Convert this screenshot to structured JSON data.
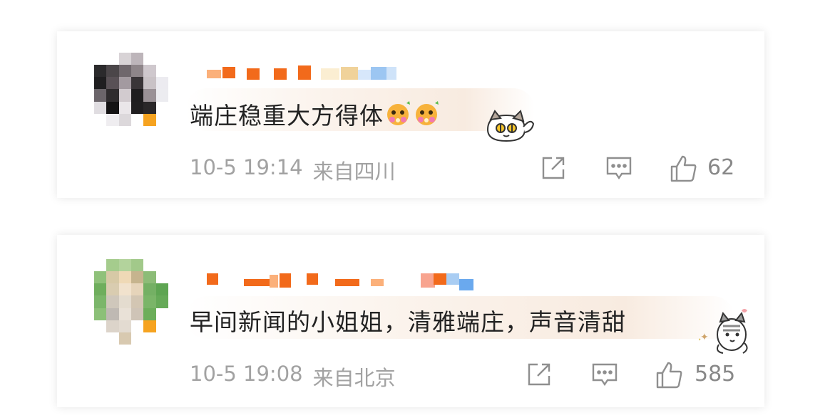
{
  "comments": [
    {
      "text": "端庄稳重大方得体",
      "emojis": [
        "flower-cheeks-emoji",
        "flower-cheeks-emoji"
      ],
      "sticker": "cat-sticker",
      "time": "10-5 19:14",
      "location": "来自四川",
      "likes": "62",
      "icons": [
        "share-icon",
        "comment-icon",
        "like-icon"
      ]
    },
    {
      "text": "早间新闻的小姐姐，清雅端庄，声音清甜",
      "sticker": "cat-sticker",
      "time": "10-5 19:08",
      "location": "来自北京",
      "likes": "585",
      "icons": [
        "share-icon",
        "comment-icon",
        "like-icon"
      ]
    }
  ],
  "colors": {
    "text": "#222222",
    "meta": "#a2a2a2",
    "icon": "#8f8f8f",
    "accent_orange": "#f26a1b",
    "accent_blue": "#6aa9ee"
  }
}
